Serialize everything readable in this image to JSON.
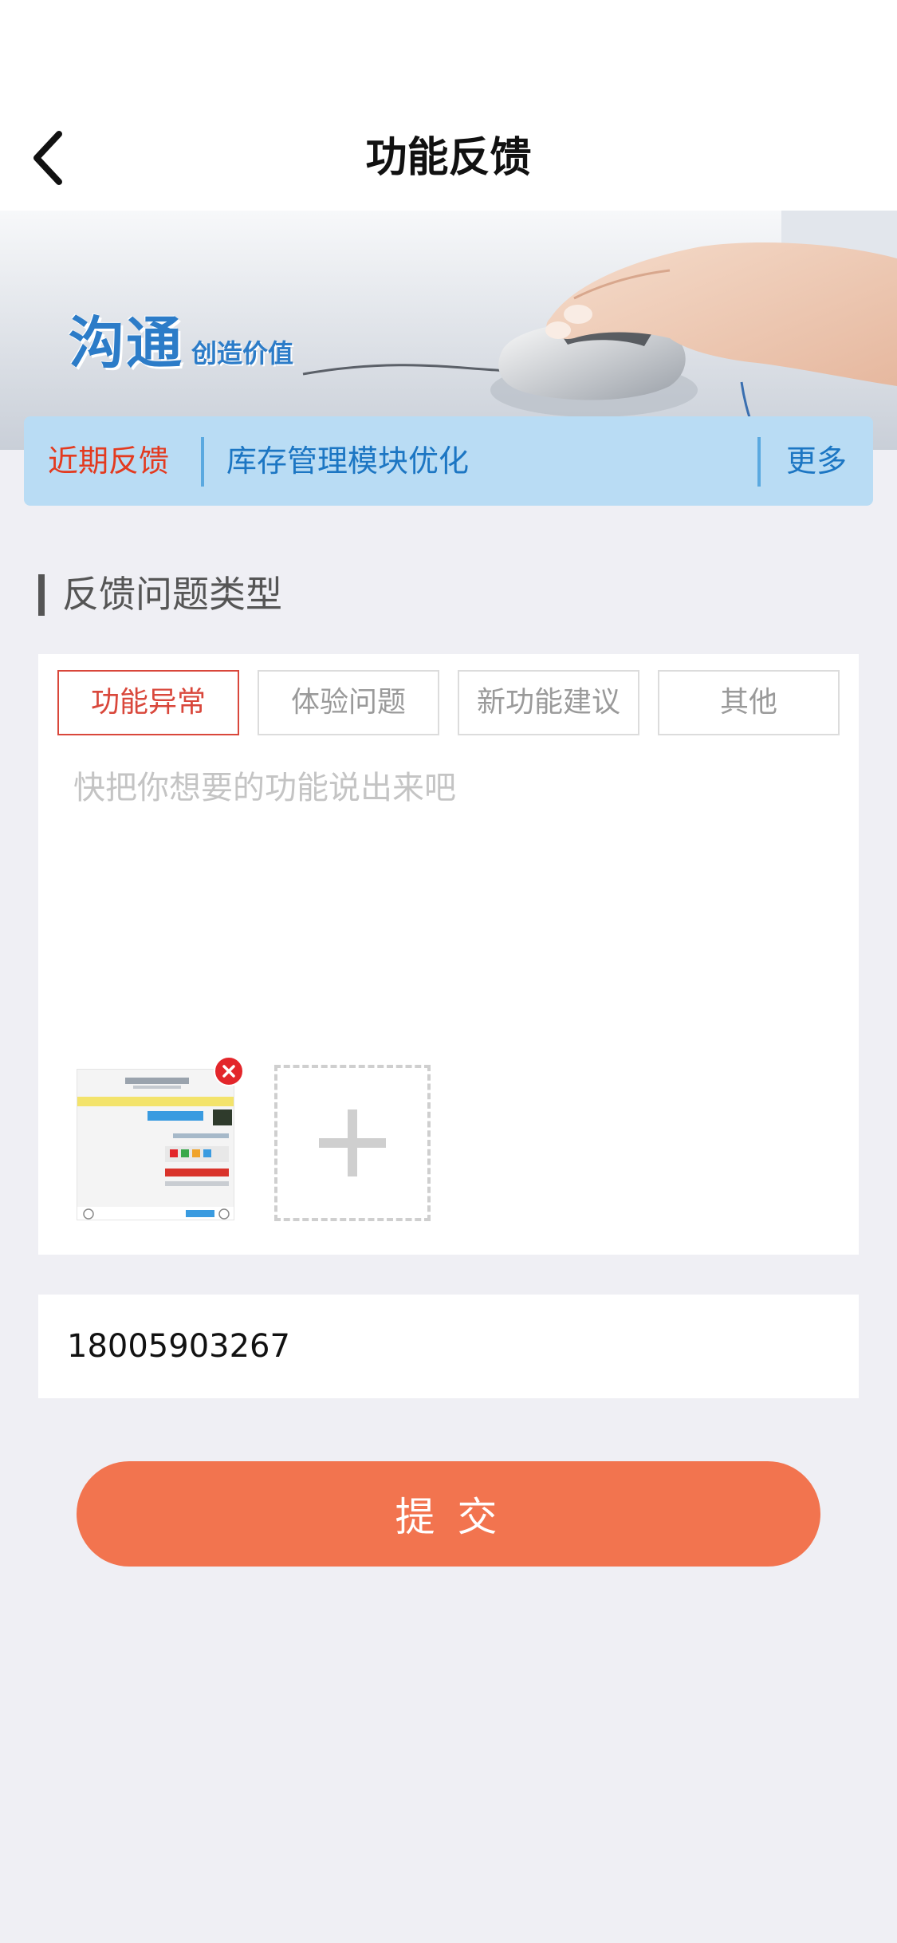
{
  "header": {
    "title": "功能反馈",
    "back_icon": "chevron-left-icon"
  },
  "banner": {
    "brand_main": "沟通",
    "brand_sub": "创造价值"
  },
  "notice": {
    "tag": "近期反馈",
    "text": "库存管理模块优化",
    "more": "更多"
  },
  "section": {
    "title": "反馈问题类型"
  },
  "types": [
    {
      "label": "功能异常",
      "selected": true
    },
    {
      "label": "体验问题",
      "selected": false
    },
    {
      "label": "新功能建议",
      "selected": false
    },
    {
      "label": "其他",
      "selected": false
    }
  ],
  "feedback": {
    "placeholder": "快把你想要的功能说出来吧",
    "value": ""
  },
  "attachments": {
    "remove_icon": "close-icon",
    "add_icon": "plus-icon"
  },
  "contact": {
    "phone": "18005903267"
  },
  "submit": {
    "label": "提 交"
  },
  "colors": {
    "accent": "#f2744f",
    "selected_red": "#d9473b",
    "notice_bg": "#b9dcf4",
    "notice_blue": "#1c76c3",
    "page_bg": "#efeff4"
  }
}
